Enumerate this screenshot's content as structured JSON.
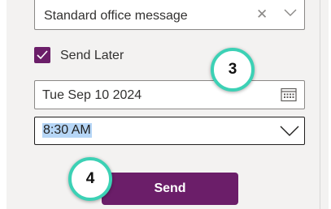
{
  "message_type": {
    "value": "Standard office message",
    "clear_icon": "close-icon",
    "expand_icon": "chevron-down-icon"
  },
  "send_later": {
    "label": "Send Later",
    "checked": true
  },
  "date_picker": {
    "value": "Tue Sep 10 2024",
    "icon": "calendar-icon"
  },
  "time_picker": {
    "value": "8:30 AM",
    "icon": "chevron-down-icon"
  },
  "send_button": {
    "label": "Send"
  },
  "callouts": {
    "step_3": "3",
    "step_4": "4"
  },
  "colors": {
    "accent": "#6b1e69",
    "callout_ring": "#3cd1b5",
    "selection": "#b6d6f6"
  }
}
